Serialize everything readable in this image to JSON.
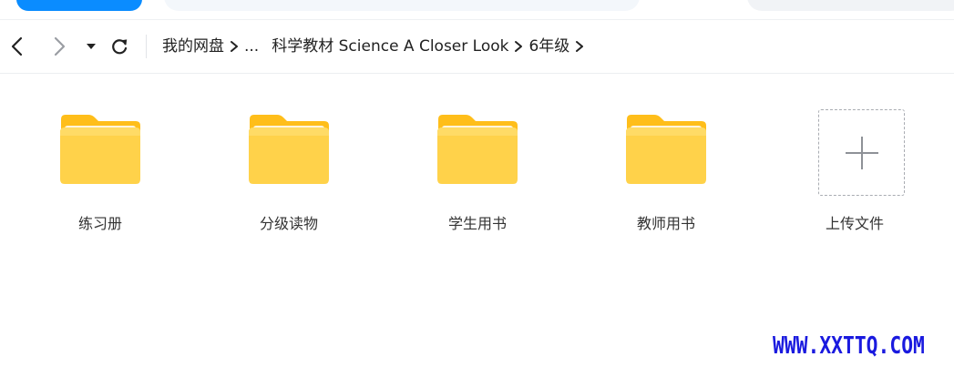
{
  "breadcrumb": {
    "items": [
      "我的网盘",
      "...",
      "科学教材 Science A Closer Look",
      "6年级"
    ]
  },
  "files": [
    {
      "name": "练习册",
      "type": "folder"
    },
    {
      "name": "分级读物",
      "type": "folder"
    },
    {
      "name": "学生用书",
      "type": "folder"
    },
    {
      "name": "教师用书",
      "type": "folder"
    }
  ],
  "upload": {
    "label": "上传文件",
    "icon": "plus-icon"
  },
  "icons": {
    "back": "chevron-left-icon",
    "forward": "chevron-right-icon",
    "history": "caret-down-icon",
    "refresh": "refresh-icon",
    "folder": "folder-icon"
  },
  "colors": {
    "accent": "#0a8cff",
    "folder_front": "#ffd24a",
    "folder_back": "#ffbe1a",
    "watermark": "#1a1adf"
  },
  "watermark": {
    "text": "WWW.XXTTQ.COM"
  }
}
